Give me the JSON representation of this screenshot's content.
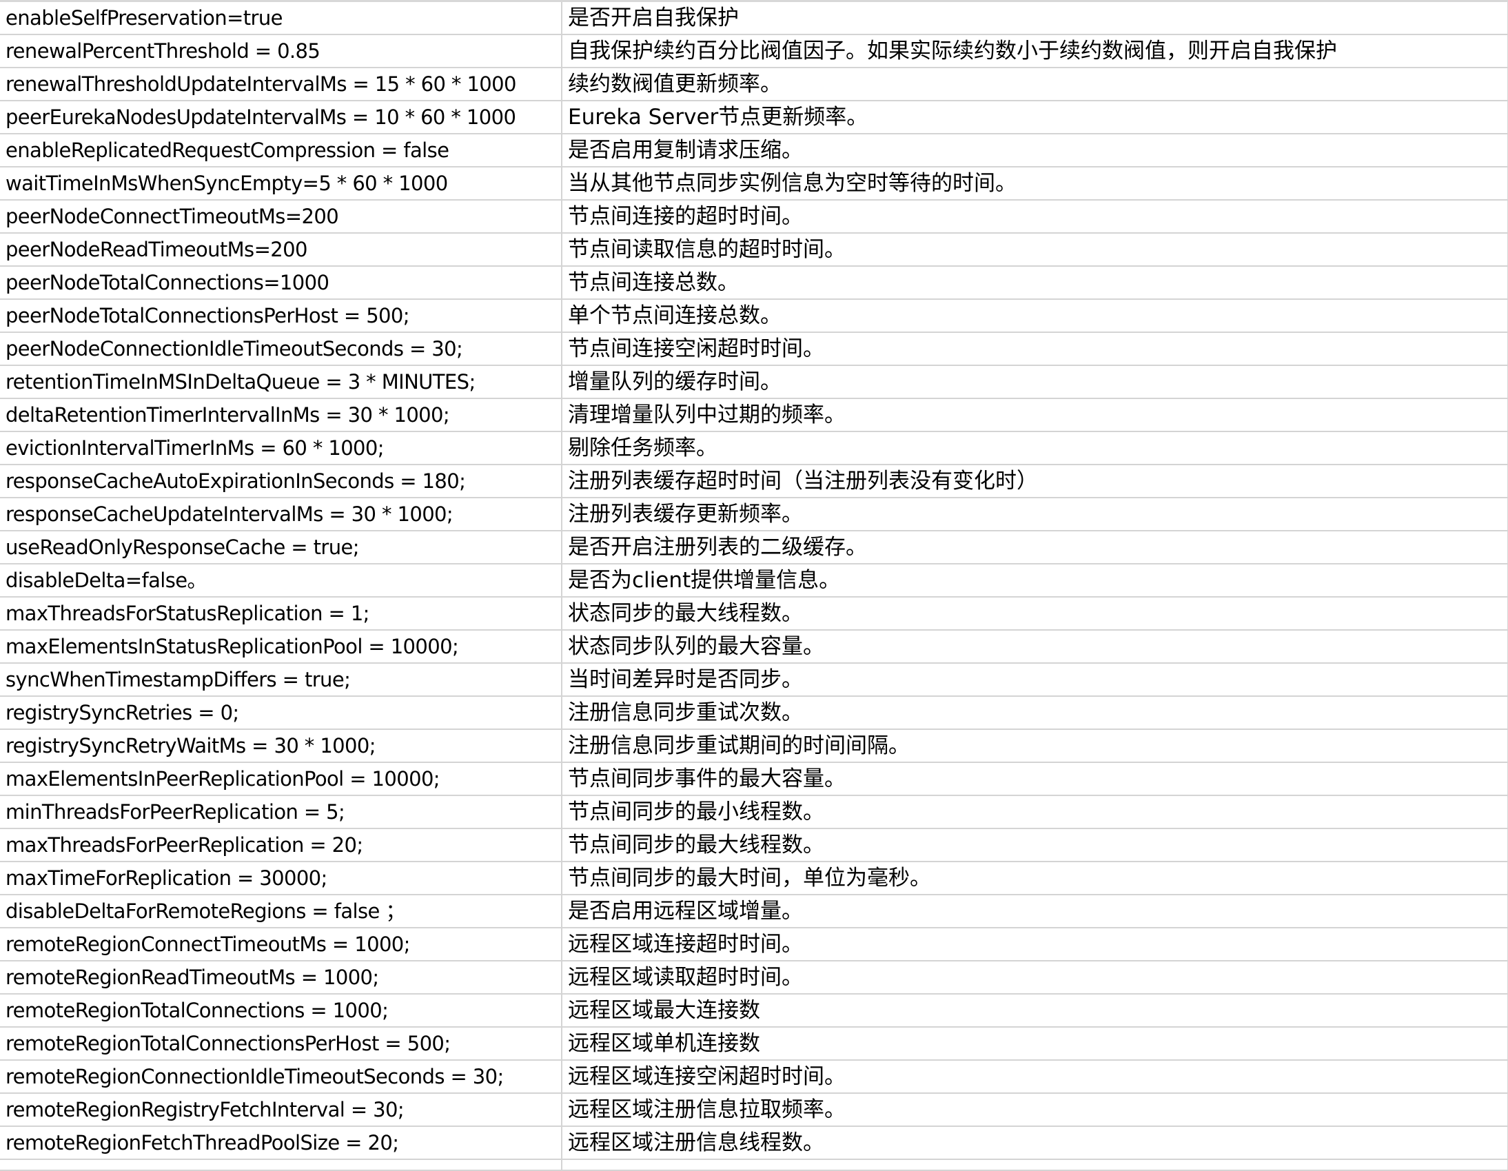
{
  "rows": [
    {
      "key": "enableSelfPreservation=true",
      "desc": "是否开启自我保护"
    },
    {
      "key": "renewalPercentThreshold = 0.85",
      "desc": "自我保护续约百分比阀值因子。如果实际续约数小于续约数阀值，则开启自我保护"
    },
    {
      "key": "renewalThresholdUpdateIntervalMs = 15 * 60 * 1000",
      "desc": "续约数阀值更新频率。"
    },
    {
      "key": "peerEurekaNodesUpdateIntervalMs = 10 * 60 * 1000",
      "desc": "Eureka Server节点更新频率。"
    },
    {
      "key": "enableReplicatedRequestCompression = false",
      "desc": "是否启用复制请求压缩。"
    },
    {
      "key": "waitTimeInMsWhenSyncEmpty=5 * 60 * 1000",
      "desc": "当从其他节点同步实例信息为空时等待的时间。"
    },
    {
      "key": "peerNodeConnectTimeoutMs=200",
      "desc": "节点间连接的超时时间。"
    },
    {
      "key": "peerNodeReadTimeoutMs=200",
      "desc": "节点间读取信息的超时时间。"
    },
    {
      "key": "peerNodeTotalConnections=1000",
      "desc": "节点间连接总数。"
    },
    {
      "key": "peerNodeTotalConnectionsPerHost = 500;",
      "desc": "单个节点间连接总数。"
    },
    {
      "key": "peerNodeConnectionIdleTimeoutSeconds = 30;",
      "desc": "节点间连接空闲超时时间。"
    },
    {
      "key": "retentionTimeInMSInDeltaQueue = 3 * MINUTES;",
      "desc": "增量队列的缓存时间。"
    },
    {
      "key": "deltaRetentionTimerIntervalInMs = 30 * 1000;",
      "desc": "清理增量队列中过期的频率。"
    },
    {
      "key": "evictionIntervalTimerInMs = 60 * 1000;",
      "desc": "剔除任务频率。"
    },
    {
      "key": "responseCacheAutoExpirationInSeconds = 180;",
      "desc": "注册列表缓存超时时间（当注册列表没有变化时）"
    },
    {
      "key": "responseCacheUpdateIntervalMs = 30 * 1000;",
      "desc": "注册列表缓存更新频率。"
    },
    {
      "key": "useReadOnlyResponseCache = true;",
      "desc": "是否开启注册列表的二级缓存。"
    },
    {
      "key": "disableDelta=false。",
      "desc": "是否为client提供增量信息。"
    },
    {
      "key": "maxThreadsForStatusReplication = 1;",
      "desc": "状态同步的最大线程数。"
    },
    {
      "key": "maxElementsInStatusReplicationPool = 10000;",
      "desc": "状态同步队列的最大容量。"
    },
    {
      "key": "syncWhenTimestampDiffers = true;",
      "desc": "当时间差异时是否同步。"
    },
    {
      "key": "registrySyncRetries = 0;",
      "desc": "注册信息同步重试次数。"
    },
    {
      "key": "registrySyncRetryWaitMs = 30 * 1000;",
      "desc": "注册信息同步重试期间的时间间隔。"
    },
    {
      "key": "maxElementsInPeerReplicationPool = 10000;",
      "desc": "节点间同步事件的最大容量。"
    },
    {
      "key": "minThreadsForPeerReplication = 5;",
      "desc": "节点间同步的最小线程数。"
    },
    {
      "key": "maxThreadsForPeerReplication = 20;",
      "desc": "节点间同步的最大线程数。"
    },
    {
      "key": "maxTimeForReplication = 30000;",
      "desc": "节点间同步的最大时间，单位为毫秒。"
    },
    {
      "key": "disableDeltaForRemoteRegions = false ；",
      "desc": "是否启用远程区域增量。"
    },
    {
      "key": "remoteRegionConnectTimeoutMs = 1000;",
      "desc": "远程区域连接超时时间。"
    },
    {
      "key": "remoteRegionReadTimeoutMs = 1000;",
      "desc": "远程区域读取超时时间。"
    },
    {
      "key": "remoteRegionTotalConnections = 1000;",
      "desc": "远程区域最大连接数"
    },
    {
      "key": "remoteRegionTotalConnectionsPerHost = 500;",
      "desc": "远程区域单机连接数"
    },
    {
      "key": "remoteRegionConnectionIdleTimeoutSeconds = 30;",
      "desc": "远程区域连接空闲超时时间。"
    },
    {
      "key": "remoteRegionRegistryFetchInterval = 30;",
      "desc": "远程区域注册信息拉取频率。"
    },
    {
      "key": "remoteRegionFetchThreadPoolSize = 20;",
      "desc": "远程区域注册信息线程数。"
    }
  ]
}
